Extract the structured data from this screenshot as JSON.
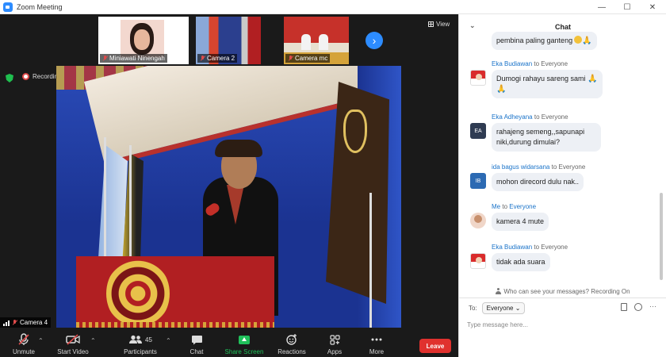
{
  "window": {
    "title": "Zoom Meeting",
    "minimize": "—",
    "maximize": "☐",
    "close": "✕"
  },
  "thumbnails": [
    {
      "name": "Miniawati Ninengah"
    },
    {
      "name": "Camera 2"
    },
    {
      "name": "Camera mc"
    }
  ],
  "view_label": "View",
  "recording_label": "Recording",
  "main_camera_label": "Camera 4",
  "toolbar": {
    "unmute": "Unmute",
    "start_video": "Start Video",
    "participants": "Participants",
    "participants_count": "45",
    "chat": "Chat",
    "share_screen": "Share Screen",
    "reactions": "Reactions",
    "apps": "Apps",
    "more": "More",
    "leave": "Leave"
  },
  "chat": {
    "title": "Chat",
    "messages": [
      {
        "sender": "",
        "to": "",
        "text": "pembina paling ganteng"
      },
      {
        "sender": "Eka Budiawan",
        "to": "to Everyone",
        "text": "Dumogi rahayu sareng sami"
      },
      {
        "sender": "Eka Adheyana",
        "to": "to Everyone",
        "initials": "EA",
        "text": "rahajeng semeng,,sapunapi niki,durung dimulai?"
      },
      {
        "sender": "ida bagus widarsana",
        "to": "to Everyone",
        "initials": "IB",
        "text": "mohon direcord dulu nak.."
      },
      {
        "sender": "Me",
        "to": "to",
        "to_target": "Everyone",
        "text": "kamera 4 mute"
      },
      {
        "sender": "Eka Budiawan",
        "to": "to Everyone",
        "text": "tidak ada suara"
      }
    ],
    "privacy_note": "Who can see your messages? Recording On",
    "to_label": "To:",
    "to_value": "Everyone",
    "input_placeholder": "Type message here..."
  },
  "colors": {
    "accent": "#2d8cff",
    "leave": "#e0312e",
    "share": "#20c05a",
    "sender": "#1a73c9"
  }
}
